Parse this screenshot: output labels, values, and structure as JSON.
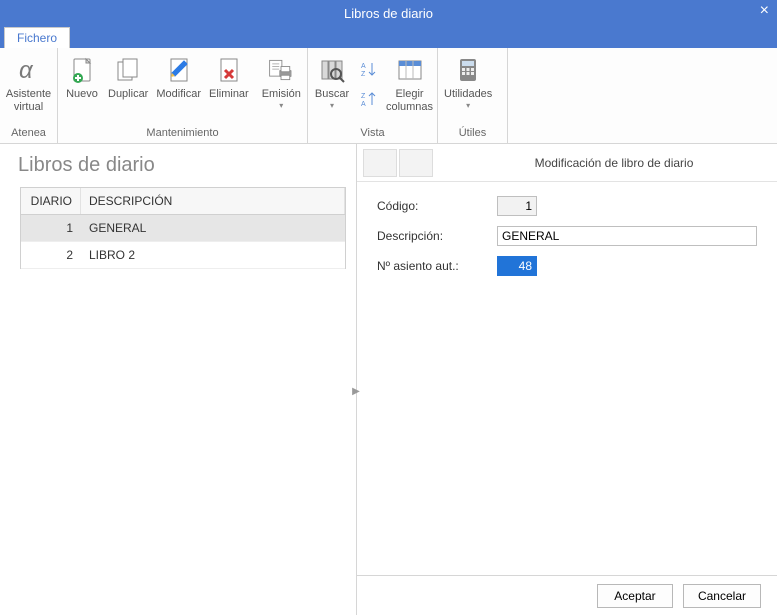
{
  "window": {
    "title": "Libros de diario"
  },
  "tabs": {
    "fichero": "Fichero"
  },
  "ribbon": {
    "atenea": {
      "group": "Atenea",
      "asistente": "Asistente\nvirtual"
    },
    "mant": {
      "group": "Mantenimiento",
      "nuevo": "Nuevo",
      "duplicar": "Duplicar",
      "modificar": "Modificar",
      "eliminar": "Eliminar",
      "emision": "Emisión"
    },
    "vista": {
      "group": "Vista",
      "buscar": "Buscar",
      "elegir": "Elegir\ncolumnas"
    },
    "utiles": {
      "group": "Útiles",
      "utilidades": "Utilidades"
    }
  },
  "left": {
    "heading": "Libros de diario",
    "cols": {
      "diario": "DIARIO",
      "desc": "DESCRIPCIÓN"
    },
    "rows": [
      {
        "diario": "1",
        "desc": "GENERAL",
        "selected": true
      },
      {
        "diario": "2",
        "desc": "LIBRO 2",
        "selected": false
      }
    ]
  },
  "detail": {
    "title": "Modificación de libro de diario",
    "codigo_label": "Código:",
    "codigo_value": "1",
    "desc_label": "Descripción:",
    "desc_value": "GENERAL",
    "asiento_label": "Nº asiento aut.:",
    "asiento_value": "48"
  },
  "footer": {
    "aceptar": "Aceptar",
    "cancelar": "Cancelar"
  }
}
